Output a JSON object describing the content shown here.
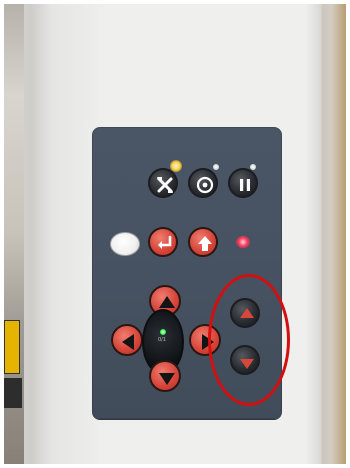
{
  "panel": {
    "center_label": "0/1"
  },
  "colors": {
    "panel": "#465261",
    "red_button": "#d7473b",
    "dark_button": "#202326",
    "highlight_ring": "#d30f0f"
  },
  "icons": [
    "crossed-tools-icon",
    "target-icon",
    "pause-icon",
    "enter-icon",
    "arrow-up-icon",
    "arrow-left-icon",
    "arrow-right-icon",
    "arrow-down-icon"
  ]
}
